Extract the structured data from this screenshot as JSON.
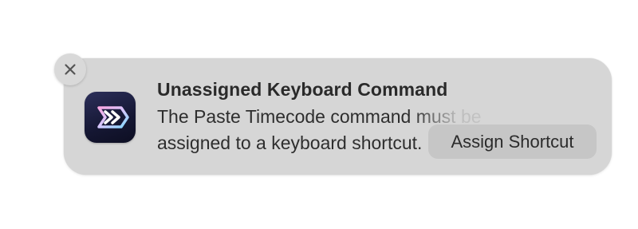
{
  "notification": {
    "title": "Unassigned Keyboard Command",
    "body_line1": "The Paste Timecode command must be",
    "body_line2": "assigned to a keyboard shortcut.",
    "action_label": "Assign Shortcut",
    "close_icon": "close-icon",
    "app_icon": "double-chevron-app-icon",
    "colors": {
      "panel": "#d6d6d6",
      "button": "#c6c6c6",
      "icon_bg": "#151733",
      "icon_accent_pink": "#f08cd6",
      "icon_accent_blue": "#7fd6ff"
    }
  }
}
